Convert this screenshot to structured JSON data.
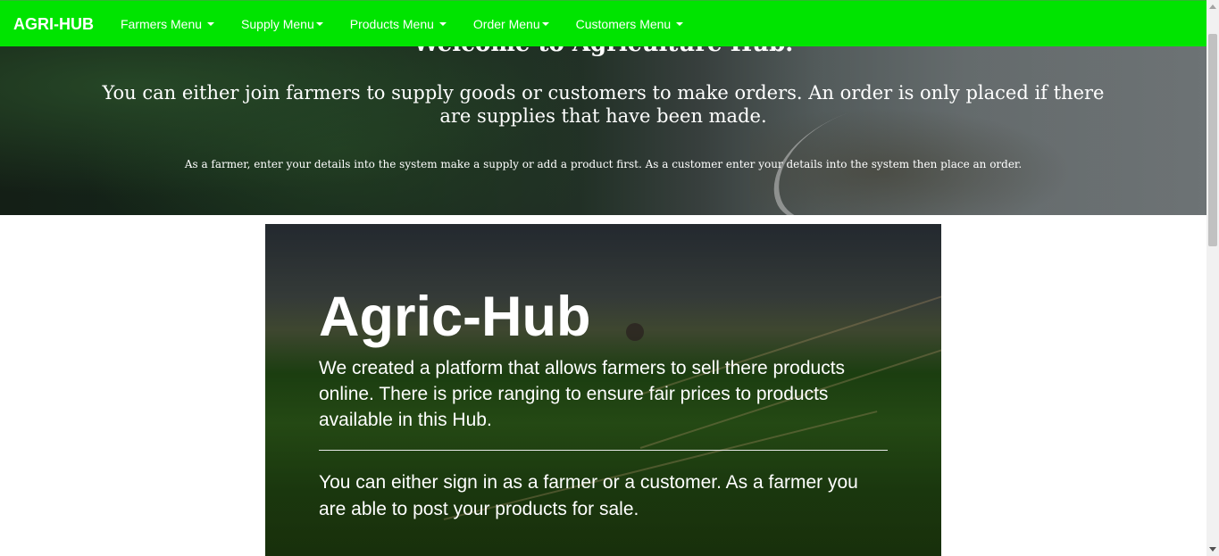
{
  "navbar": {
    "brand": "AGRI-HUB",
    "menus": [
      {
        "label": "Farmers Menu"
      },
      {
        "label": "Supply Menu"
      },
      {
        "label": "Products Menu"
      },
      {
        "label": "Order Menu"
      },
      {
        "label": "Customers Menu"
      }
    ],
    "color": "#00e400"
  },
  "hero": {
    "title": "Welcome to Agriculture Hub.",
    "lead": "You can either join farmers to supply goods or customers to make orders. An order is only placed if there are supplies that have been made.",
    "small": "As a farmer, enter your details into the system make a supply or add a product first. As a customer enter your details into the system then place an order."
  },
  "card": {
    "title": "Agric-Hub",
    "paragraph1": "We created a platform that allows farmers to sell there products online. There is price ranging to ensure fair prices to products available in this Hub.",
    "paragraph2": "You can either sign in as a farmer or a customer. As a farmer you are able to post your products for sale."
  }
}
